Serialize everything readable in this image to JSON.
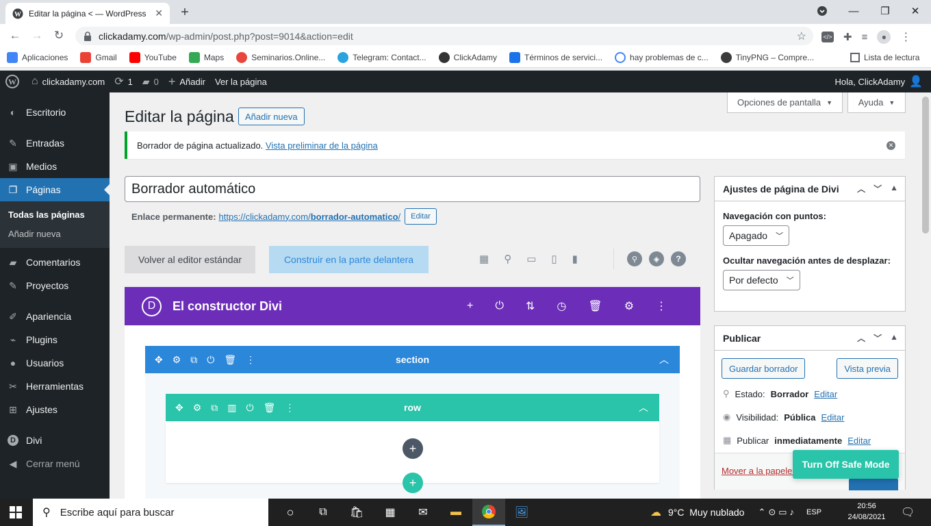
{
  "browser": {
    "tab_title": "Editar la página < — WordPress",
    "url_host": "clickadamy.com",
    "url_path": "/wp-admin/post.php?post=9014&action=edit",
    "bookmarks": [
      {
        "label": "Aplicaciones",
        "color": "#4285f4"
      },
      {
        "label": "Gmail",
        "color": "#ea4335"
      },
      {
        "label": "YouTube",
        "color": "#ff0000"
      },
      {
        "label": "Maps",
        "color": "#34a853"
      },
      {
        "label": "Seminarios.Online...",
        "color": "#e8453c"
      },
      {
        "label": "Telegram: Contact...",
        "color": "#2aa3de"
      },
      {
        "label": "ClickAdamy",
        "color": "#333333"
      },
      {
        "label": "Términos de servici...",
        "color": "#1a73e8"
      },
      {
        "label": "hay problemas de c...",
        "color": "#4285f4"
      },
      {
        "label": "TinyPNG – Compre...",
        "color": "#3c3c3c"
      }
    ],
    "reading_list": "Lista de lectura"
  },
  "adminbar": {
    "site": "clickadamy.com",
    "updates": "1",
    "comments": "0",
    "add": "Añadir",
    "view": "Ver la página",
    "greeting": "Hola, ClickAdamy"
  },
  "sidebar": {
    "items": [
      {
        "label": "Escritorio",
        "icon": "dashboard-icon"
      },
      {
        "label": "Entradas",
        "icon": "pin-icon"
      },
      {
        "label": "Medios",
        "icon": "media-icon"
      },
      {
        "label": "Páginas",
        "icon": "pages-icon"
      },
      {
        "label": "Comentarios",
        "icon": "comment-icon"
      },
      {
        "label": "Proyectos",
        "icon": "pin-icon"
      },
      {
        "label": "Apariencia",
        "icon": "brush-icon"
      },
      {
        "label": "Plugins",
        "icon": "plug-icon"
      },
      {
        "label": "Usuarios",
        "icon": "user-icon"
      },
      {
        "label": "Herramientas",
        "icon": "wrench-icon"
      },
      {
        "label": "Ajustes",
        "icon": "settings-icon"
      },
      {
        "label": "Divi",
        "icon": "divi-icon"
      },
      {
        "label": "Cerrar menú",
        "icon": "collapse-icon"
      }
    ],
    "sub_all": "Todas las páginas",
    "sub_add": "Añadir nueva"
  },
  "page": {
    "heading": "Editar la página",
    "add_new": "Añadir nueva",
    "screen_options": "Opciones de pantalla",
    "help": "Ayuda",
    "notice_text": "Borrador de página actualizado.",
    "notice_link": "Vista preliminar de la página",
    "title_value": "Borrador automático",
    "permalink_label": "Enlace permanente:",
    "permalink_base": "https://clickadamy.com/",
    "permalink_slug": "borrador-automatico",
    "permalink_end": "/",
    "permalink_edit": "Editar",
    "btn_standard": "Volver al editor estándar",
    "btn_frontend": "Construir en la parte delantera",
    "divi_title": "El constructor Divi",
    "section_label": "section",
    "row_label": "row"
  },
  "divi_settings": {
    "title": "Ajustes de página de Divi",
    "dots_label": "Navegación con puntos:",
    "dots_value": "Apagado",
    "hide_label": "Ocultar navegación antes de desplazar:",
    "hide_value": "Por defecto"
  },
  "publish": {
    "title": "Publicar",
    "save_draft": "Guardar borrador",
    "preview": "Vista previa",
    "status_label": "Estado:",
    "status_value": "Borrador",
    "visibility_label": "Visibilidad:",
    "visibility_value": "Pública",
    "publish_label": "Publicar",
    "publish_value": "inmediatamente",
    "edit": "Editar",
    "trash": "Mover a la papelera",
    "safe_mode": "Turn Off Safe Mode"
  },
  "taskbar": {
    "search_placeholder": "Escribe aquí para buscar",
    "weather": "9°C  Muy nublado",
    "lang": "ESP",
    "time": "20:56",
    "date": "24/08/2021"
  },
  "colors": {
    "divi_purple": "#6c2eb9",
    "section_blue": "#2b87da",
    "row_teal": "#29c4a9",
    "wp_blue": "#2271b1",
    "admin_dark": "#1d2327"
  }
}
